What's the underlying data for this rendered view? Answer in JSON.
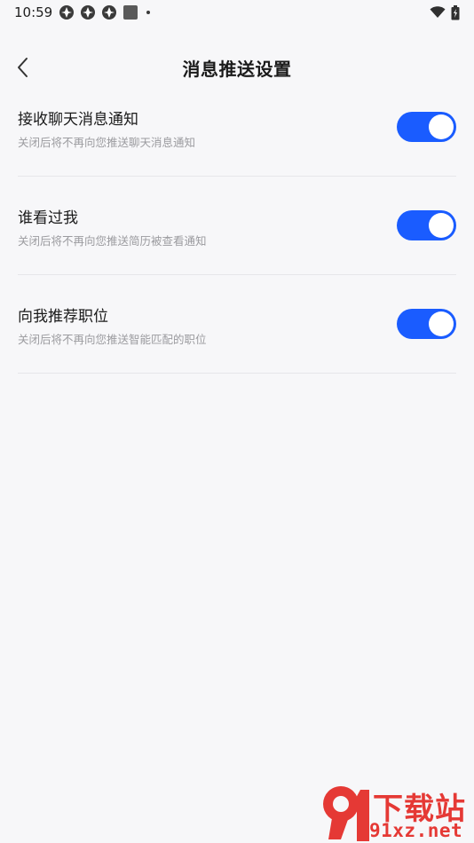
{
  "status_bar": {
    "time": "10:59"
  },
  "header": {
    "title": "消息推送设置"
  },
  "settings": [
    {
      "title": "接收聊天消息通知",
      "description": "关闭后将不再向您推送聊天消息通知",
      "enabled": true
    },
    {
      "title": "谁看过我",
      "description": "关闭后将不再向您推送简历被查看通知",
      "enabled": true
    },
    {
      "title": "向我推荐职位",
      "description": "关闭后将不再向您推送智能匹配的职位",
      "enabled": true
    }
  ],
  "watermark": {
    "line1": "下载站",
    "line2": "91xz.net"
  },
  "colors": {
    "accent": "#1a5cff",
    "background": "#f7f7f9",
    "watermark": "#e53935"
  }
}
